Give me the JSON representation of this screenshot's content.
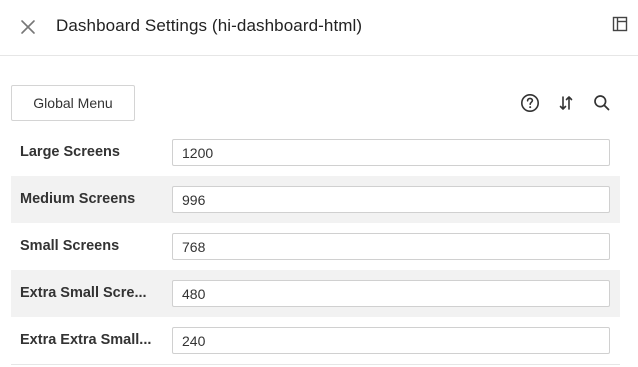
{
  "header": {
    "title": "Dashboard Settings (hi-dashboard-html)",
    "close_icon": "close-icon",
    "panel_icon": "panel-layout-icon"
  },
  "toolbar": {
    "global_menu_label": "Global Menu",
    "icons": [
      "help-icon",
      "sort-icon",
      "search-icon"
    ]
  },
  "settings": {
    "rows": [
      {
        "label": "Large Screens",
        "value": "1200"
      },
      {
        "label": "Medium Screens",
        "value": "996"
      },
      {
        "label": "Small Screens",
        "value": "768"
      },
      {
        "label": "Extra Small Scre...",
        "value": "480"
      },
      {
        "label": "Extra Extra Small...",
        "value": "240"
      }
    ]
  },
  "colors": {
    "alt_row_bg": "#f2f2f2",
    "border": "#d0d0d0",
    "text": "#333333"
  }
}
